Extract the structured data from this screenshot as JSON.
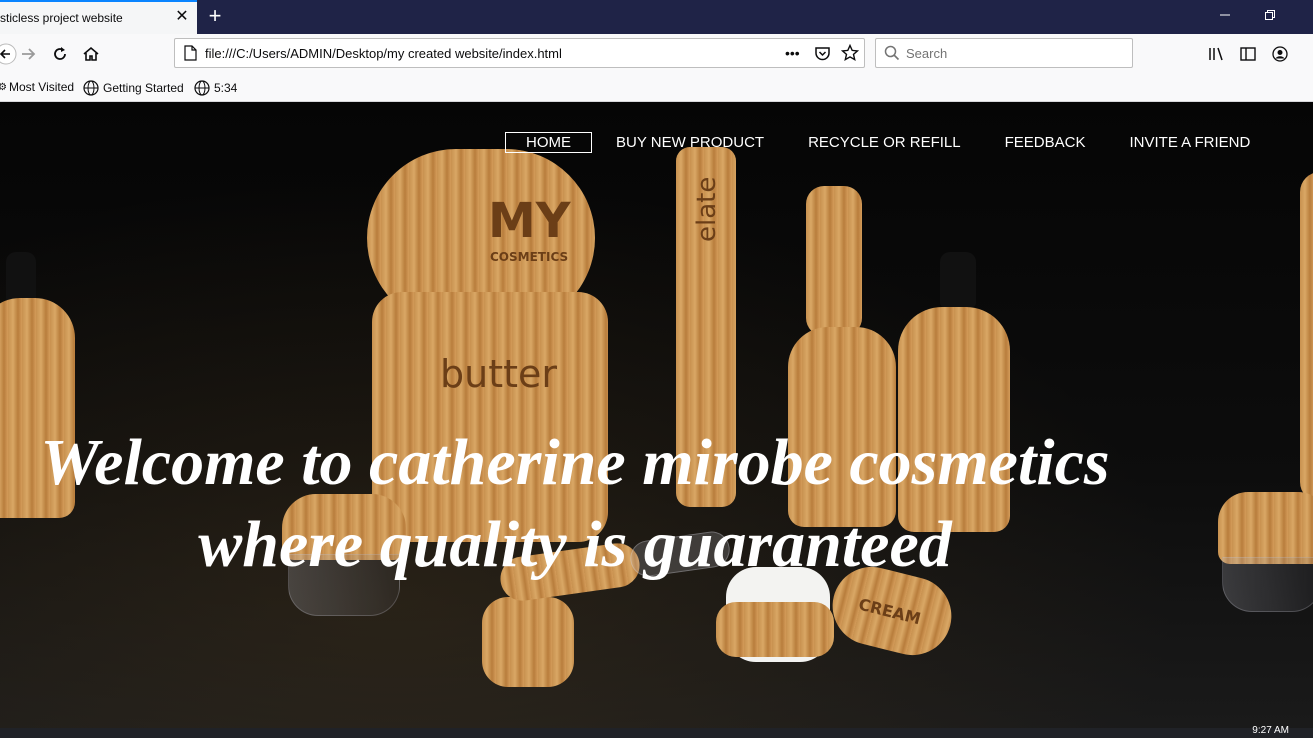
{
  "browser": {
    "tab_title": "sticless project website",
    "tab_close": "✕",
    "new_tab": "+",
    "url": "file:///C:/Users/ADMIN/Desktop/my created website/index.html",
    "search_placeholder": "Search",
    "page_actions": "•••",
    "accent_color": "#0a84ff",
    "titlebar_color": "#1f2347"
  },
  "bookmarks": [
    {
      "label": "Most Visited"
    },
    {
      "label": "Getting Started"
    },
    {
      "label": "5:34"
    }
  ],
  "site": {
    "nav": [
      {
        "label": "HOME",
        "active": true
      },
      {
        "label": "BUY NEW PRODUCT",
        "active": false
      },
      {
        "label": "RECYCLE OR REFILL",
        "active": false
      },
      {
        "label": "FEEDBACK",
        "active": false
      },
      {
        "label": "INVITE A FRIEND",
        "active": false
      }
    ],
    "headline_line1": "Welcome to catherine mirobe cosmetics",
    "headline_line2": "where quality is guaranteed",
    "product_labels": {
      "jar_top_line1": "MY",
      "jar_top_line2": "COSMETICS",
      "jar_side": "butter",
      "tube": "elate",
      "cream_lid": "CREAM"
    }
  },
  "taskbar": {
    "clock": "9:27 AM"
  }
}
